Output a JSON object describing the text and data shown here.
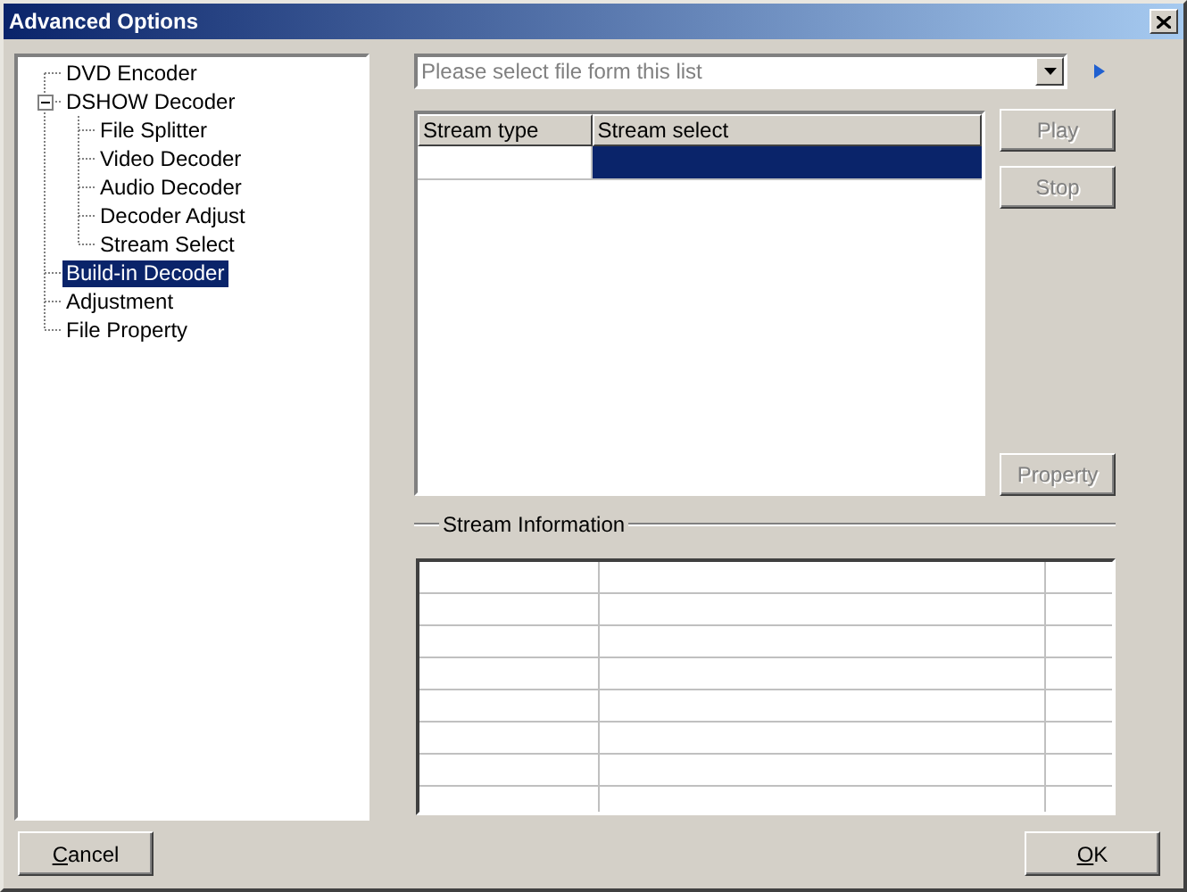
{
  "window": {
    "title": "Advanced Options"
  },
  "tree": [
    {
      "label": "DVD Encoder",
      "selected": false
    },
    {
      "label": "DSHOW Decoder",
      "selected": false,
      "expanded": true,
      "children": [
        {
          "label": "File Splitter",
          "selected": false
        },
        {
          "label": "Video Decoder",
          "selected": false
        },
        {
          "label": "Audio Decoder",
          "selected": false
        },
        {
          "label": "Decoder Adjust",
          "selected": false
        },
        {
          "label": "Stream Select",
          "selected": false
        }
      ]
    },
    {
      "label": "Build-in Decoder",
      "selected": true
    },
    {
      "label": "Adjustment",
      "selected": false
    },
    {
      "label": "File Property",
      "selected": false
    }
  ],
  "file_select": {
    "placeholder": "Please select file form this list"
  },
  "stream_table": {
    "columns": [
      "Stream type",
      "Stream select"
    ],
    "rows": [
      {
        "selected": true
      }
    ]
  },
  "side_buttons": [
    {
      "label": "Play",
      "disabled": true
    },
    {
      "label": "Stop",
      "disabled": true
    },
    {
      "label": "Property",
      "disabled": true
    }
  ],
  "stream_information": {
    "title": "Stream Information"
  },
  "buttons": [
    {
      "label": "Cancel",
      "underline_first": true,
      "disabled": false
    },
    {
      "label": "OK",
      "underline_first": true,
      "disabled": false
    }
  ]
}
